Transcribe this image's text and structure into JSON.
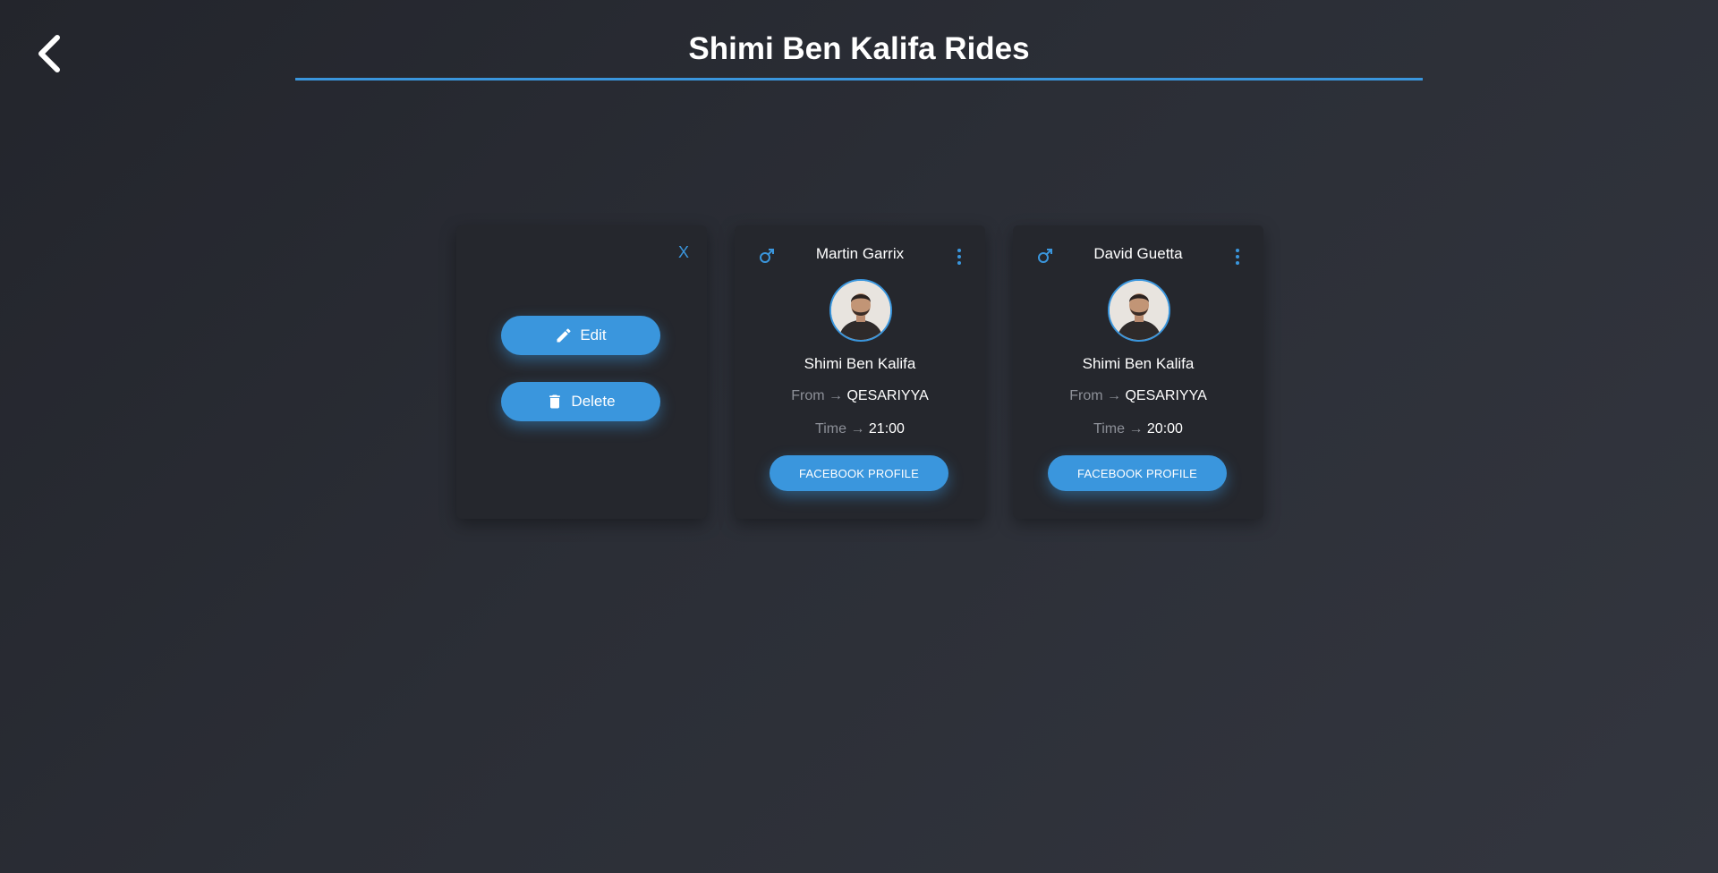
{
  "page": {
    "title": "Shimi Ben Kalifa Rides",
    "accent_color": "#3a96dd",
    "back_icon": "chevron-left-icon"
  },
  "menu_card": {
    "close_label": "X",
    "edit_label": "Edit",
    "edit_icon": "pencil-icon",
    "delete_label": "Delete",
    "delete_icon": "trash-icon"
  },
  "rides": [
    {
      "gender_icon": "male-icon",
      "card_name": "Martin Garrix",
      "driver_name": "Shimi Ben Kalifa",
      "from_label": "From →",
      "from_value": "QESARIYYA",
      "time_label": "Time →",
      "time_value": "21:00",
      "button_label": "FACEBOOK PROFILE"
    },
    {
      "gender_icon": "male-icon",
      "card_name": "David Guetta",
      "driver_name": "Shimi Ben Kalifa",
      "from_label": "From →",
      "from_value": "QESARIYYA",
      "time_label": "Time →",
      "time_value": "20:00",
      "button_label": "FACEBOOK PROFILE"
    }
  ]
}
